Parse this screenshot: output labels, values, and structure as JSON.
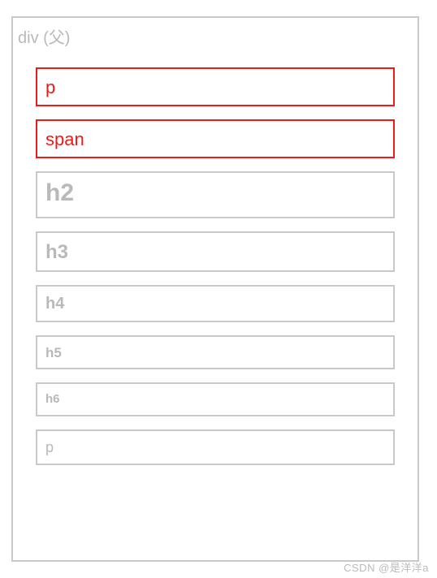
{
  "parent_label": "div (父)",
  "children": [
    {
      "label": "p",
      "selected": true,
      "class": "c-p"
    },
    {
      "label": "span",
      "selected": true,
      "class": "c-span"
    },
    {
      "label": "h2",
      "selected": false,
      "class": "c-h2"
    },
    {
      "label": "h3",
      "selected": false,
      "class": "c-h3"
    },
    {
      "label": "h4",
      "selected": false,
      "class": "c-h4"
    },
    {
      "label": "h5",
      "selected": false,
      "class": "c-h5"
    },
    {
      "label": "h6",
      "selected": false,
      "class": "c-h6"
    },
    {
      "label": "p",
      "selected": false,
      "class": "c-p2"
    }
  ],
  "watermark": "CSDN @是洋洋a"
}
